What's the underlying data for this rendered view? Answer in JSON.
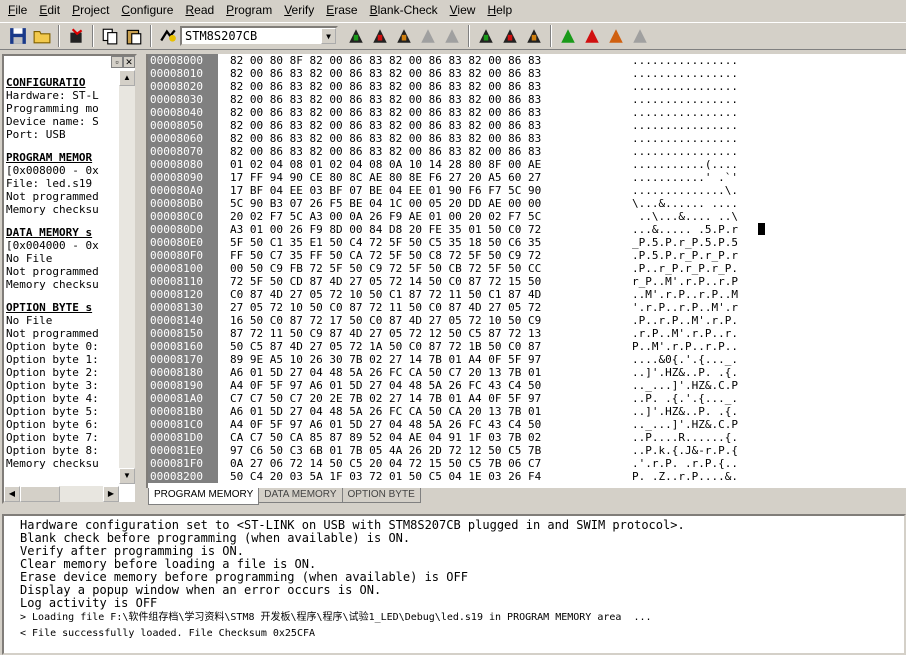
{
  "menu": [
    {
      "label": "File",
      "hotkey": "F",
      "rest": "ile"
    },
    {
      "label": "Edit",
      "hotkey": "E",
      "rest": "dit"
    },
    {
      "label": "Project",
      "hotkey": "P",
      "rest": "roject"
    },
    {
      "label": "Configure",
      "hotkey": "C",
      "rest": "onfigure"
    },
    {
      "label": "Read",
      "hotkey": "R",
      "rest": "ead"
    },
    {
      "label": "Program",
      "hotkey": "P",
      "rest": "rogram"
    },
    {
      "label": "Verify",
      "hotkey": "V",
      "rest": "erify"
    },
    {
      "label": "Erase",
      "hotkey": "E",
      "rest": "rase"
    },
    {
      "label": "Blank-Check",
      "hotkey": "B",
      "rest": "lank-Check"
    },
    {
      "label": "View",
      "hotkey": "V",
      "rest": "iew"
    },
    {
      "label": "Help",
      "hotkey": "H",
      "rest": "elp"
    }
  ],
  "toolbar": {
    "device": "STM8S207CB"
  },
  "left_panel": [
    {
      "type": "sec",
      "text": "CONFIGURATIO"
    },
    {
      "type": "line",
      "text": "Hardware: ST-L"
    },
    {
      "type": "line",
      "text": "Programming mo"
    },
    {
      "type": "line",
      "text": "Device name: S"
    },
    {
      "type": "line",
      "text": "Port: USB"
    },
    {
      "type": "gap",
      "text": ""
    },
    {
      "type": "sec",
      "text": "PROGRAM MEMOR"
    },
    {
      "type": "line",
      "text": "[0x008000 - 0x"
    },
    {
      "type": "line",
      "text": "File: led.s19"
    },
    {
      "type": "line",
      "text": "Not programmed"
    },
    {
      "type": "line",
      "text": "Memory checksu"
    },
    {
      "type": "gap",
      "text": ""
    },
    {
      "type": "sec",
      "text": "DATA MEMORY s"
    },
    {
      "type": "line",
      "text": "[0x004000 - 0x"
    },
    {
      "type": "line",
      "text": "No File"
    },
    {
      "type": "line",
      "text": "Not programmed"
    },
    {
      "type": "line",
      "text": "Memory checksu"
    },
    {
      "type": "gap",
      "text": ""
    },
    {
      "type": "sec",
      "text": "OPTION BYTE s"
    },
    {
      "type": "line",
      "text": "No File"
    },
    {
      "type": "line",
      "text": "Not programmed"
    },
    {
      "type": "line",
      "text": "Option byte 0:"
    },
    {
      "type": "line",
      "text": "Option byte 1:"
    },
    {
      "type": "line",
      "text": "Option byte 2:"
    },
    {
      "type": "line",
      "text": "Option byte 3:"
    },
    {
      "type": "line",
      "text": "Option byte 4:"
    },
    {
      "type": "line",
      "text": "Option byte 5:"
    },
    {
      "type": "line",
      "text": "Option byte 6:"
    },
    {
      "type": "line",
      "text": "Option byte 7:"
    },
    {
      "type": "line",
      "text": "Option byte 8:"
    },
    {
      "type": "line",
      "text": "Memory checksu"
    }
  ],
  "hex_rows": [
    {
      "addr": "00008000",
      "bytes": "82 00 80 8F 82 00 86 83 82 00 86 83 82 00 86 83",
      "ascii": "................"
    },
    {
      "addr": "00008010",
      "bytes": "82 00 86 83 82 00 86 83 82 00 86 83 82 00 86 83",
      "ascii": "................"
    },
    {
      "addr": "00008020",
      "bytes": "82 00 86 83 82 00 86 83 82 00 86 83 82 00 86 83",
      "ascii": "................"
    },
    {
      "addr": "00008030",
      "bytes": "82 00 86 83 82 00 86 83 82 00 86 83 82 00 86 83",
      "ascii": "................"
    },
    {
      "addr": "00008040",
      "bytes": "82 00 86 83 82 00 86 83 82 00 86 83 82 00 86 83",
      "ascii": "................"
    },
    {
      "addr": "00008050",
      "bytes": "82 00 86 83 82 00 86 83 82 00 86 83 82 00 86 83",
      "ascii": "................"
    },
    {
      "addr": "00008060",
      "bytes": "82 00 86 83 82 00 86 83 82 00 86 83 82 00 86 83",
      "ascii": "................"
    },
    {
      "addr": "00008070",
      "bytes": "82 00 86 83 82 00 86 83 82 00 86 83 82 00 86 83",
      "ascii": "................"
    },
    {
      "addr": "00008080",
      "bytes": "01 02 04 08 01 02 04 08 0A 10 14 28 80 8F 00 AE",
      "ascii": "...........(...."
    },
    {
      "addr": "00008090",
      "bytes": "17 FF 94 90 CE 80 8C AE 80 8E F6 27 20 A5 60 27",
      "ascii": "...........' .`'"
    },
    {
      "addr": "000080A0",
      "bytes": "17 BF 04 EE 03 BF 07 BE 04 EE 01 90 F6 F7 5C 90",
      "ascii": "..............\\."
    },
    {
      "addr": "000080B0",
      "bytes": "5C 90 B3 07 26 F5 BE 04 1C 00 05 20 DD AE 00 00",
      "ascii": "\\...&...... ...."
    },
    {
      "addr": "000080C0",
      "bytes": "20 02 F7 5C A3 00 0A 26 F9 AE 01 00 20 02 F7 5C",
      "ascii": " ..\\...&.... ..\\"
    },
    {
      "addr": "000080D0",
      "bytes": "A3 01 00 26 F9 8D 00 84 D8 20 FE 35 01 50 C0 72",
      "ascii": "...&..... .5.P.r"
    },
    {
      "addr": "000080E0",
      "bytes": "5F 50 C1 35 E1 50 C4 72 5F 50 C5 35 18 50 C6 35",
      "ascii": "_P.5.P.r_P.5.P.5"
    },
    {
      "addr": "000080F0",
      "bytes": "FF 50 C7 35 FF 50 CA 72 5F 50 C8 72 5F 50 C9 72",
      "ascii": ".P.5.P.r_P.r_P.r"
    },
    {
      "addr": "00008100",
      "bytes": "00 50 C9 FB 72 5F 50 C9 72 5F 50 CB 72 5F 50 CC",
      "ascii": ".P..r_P.r_P.r_P."
    },
    {
      "addr": "00008110",
      "bytes": "72 5F 50 CD 87 4D 27 05 72 14 50 C0 87 72 15 50",
      "ascii": "r_P..M'.r.P..r.P"
    },
    {
      "addr": "00008120",
      "bytes": "C0 87 4D 27 05 72 10 50 C1 87 72 11 50 C1 87 4D",
      "ascii": "..M'.r.P..r.P..M"
    },
    {
      "addr": "00008130",
      "bytes": "27 05 72 10 50 C0 87 72 11 50 C0 87 4D 27 05 72",
      "ascii": "'.r.P..r.P..M'.r"
    },
    {
      "addr": "00008140",
      "bytes": "16 50 C0 87 72 17 50 C0 87 4D 27 05 72 10 50 C9",
      "ascii": ".P..r.P..M'.r.P."
    },
    {
      "addr": "00008150",
      "bytes": "87 72 11 50 C9 87 4D 27 05 72 12 50 C5 87 72 13",
      "ascii": ".r.P..M'.r.P..r."
    },
    {
      "addr": "00008160",
      "bytes": "50 C5 87 4D 27 05 72 1A 50 C0 87 72 1B 50 C0 87",
      "ascii": "P..M'.r.P..r.P.."
    },
    {
      "addr": "00008170",
      "bytes": "89 9E A5 10 26 30 7B 02 27 14 7B 01 A4 0F 5F 97",
      "ascii": "....&0{.'.{..._."
    },
    {
      "addr": "00008180",
      "bytes": "A6 01 5D 27 04 48 5A 26 FC CA 50 C7 20 13 7B 01",
      "ascii": "..]'.HZ&..P. .{."
    },
    {
      "addr": "00008190",
      "bytes": "A4 0F 5F 97 A6 01 5D 27 04 48 5A 26 FC 43 C4 50",
      "ascii": ".._...]'.HZ&.C.P"
    },
    {
      "addr": "000081A0",
      "bytes": "C7 C7 50 C7 20 2E 7B 02 27 14 7B 01 A4 0F 5F 97",
      "ascii": "..P. .{.'.{..._."
    },
    {
      "addr": "000081B0",
      "bytes": "A6 01 5D 27 04 48 5A 26 FC CA 50 CA 20 13 7B 01",
      "ascii": "..]'.HZ&..P. .{."
    },
    {
      "addr": "000081C0",
      "bytes": "A4 0F 5F 97 A6 01 5D 27 04 48 5A 26 FC 43 C4 50",
      "ascii": ".._...]'.HZ&.C.P"
    },
    {
      "addr": "000081D0",
      "bytes": "CA C7 50 CA 85 87 89 52 04 AE 04 91 1F 03 7B 02",
      "ascii": "..P....R......{."
    },
    {
      "addr": "000081E0",
      "bytes": "97 C6 50 C3 6B 01 7B 05 4A 26 2D 72 12 50 C5 7B",
      "ascii": "..P.k.{.J&-r.P.{"
    },
    {
      "addr": "000081F0",
      "bytes": "0A 27 06 72 14 50 C5 20 04 72 15 50 C5 7B 06 C7",
      "ascii": ".'.r.P. .r.P.{.."
    },
    {
      "addr": "00008200",
      "bytes": "50 C4 20 03 5A 1F 03 72 01 50 C5 04 1E 03 26 F4",
      "ascii": "P. .Z..r.P....&."
    }
  ],
  "tabs": [
    "PROGRAM MEMORY",
    "DATA MEMORY",
    "OPTION BYTE"
  ],
  "log": [
    {
      "text": "Hardware configuration set to <ST-LINK on USB with STM8S207CB plugged in and SWIM protocol>.",
      "small": false
    },
    {
      "text": "Blank check before programming (when available) is ON.",
      "small": false
    },
    {
      "text": "Verify after programming is ON.",
      "small": false
    },
    {
      "text": "Clear memory before loading a file is ON.",
      "small": false
    },
    {
      "text": "Erase device memory before programming (when available) is OFF",
      "small": false
    },
    {
      "text": "Display a popup window when an error occurs is ON.",
      "small": false
    },
    {
      "text": "Log activity is OFF",
      "small": false
    },
    {
      "text": "> Loading file F:\\软件组存档\\学习资料\\STM8 开发板\\程序\\程序\\试验1_LED\\Debug\\led.s19 in PROGRAM MEMORY area  ...",
      "small": true
    },
    {
      "text": "< File successfully loaded. File Checksum 0x25CFA",
      "small": true
    }
  ]
}
